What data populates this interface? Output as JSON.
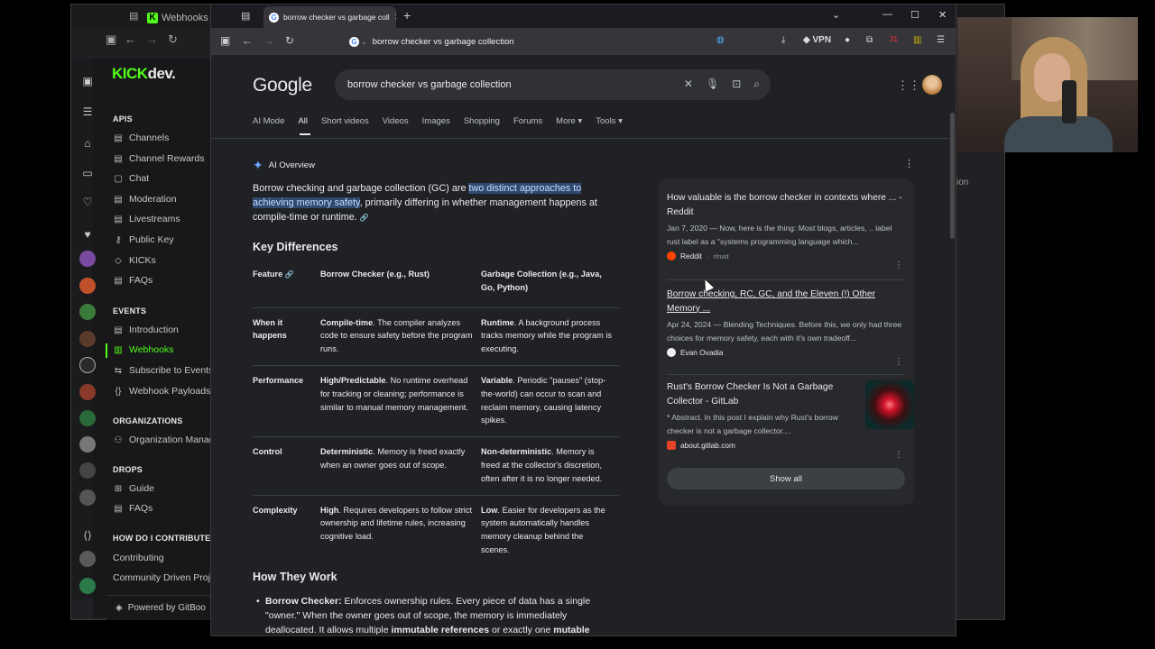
{
  "bg_window": {
    "tab_title": "Webhooks | Ki",
    "right_fragment": "ion",
    "kick": {
      "logo_kick": "KICK",
      "logo_dev": "dev.",
      "sections": [
        {
          "title": "APIS",
          "items": [
            "Channels",
            "Channel Rewards",
            "Chat",
            "Moderation",
            "Livestreams",
            "Public Key",
            "KICKs",
            "FAQs"
          ]
        },
        {
          "title": "EVENTS",
          "items": [
            "Introduction",
            "Webhooks",
            "Subscribe to Events",
            "Webhook Payloads"
          ]
        },
        {
          "title": "ORGANIZATIONS",
          "items": [
            "Organization Manag"
          ]
        },
        {
          "title": "DROPS",
          "items": [
            "Guide",
            "FAQs"
          ]
        },
        {
          "title": "HOW DO I CONTRIBUTE?",
          "items": [
            "Contributing",
            "Community Driven Proje"
          ]
        }
      ],
      "active_item": "Webhooks",
      "gitbook": "Powered by GitBoo"
    }
  },
  "browser": {
    "tab_title": "borrow checker vs garbage coll",
    "address": "borrow checker vs garbage collection",
    "vpn_label": "VPN",
    "badge_count": "31"
  },
  "google": {
    "logo": "Google",
    "query": "borrow checker vs garbage collection",
    "tabs": [
      "AI Mode",
      "All",
      "Short videos",
      "Videos",
      "Images",
      "Shopping",
      "Forums",
      "More",
      "Tools"
    ],
    "active_tab": "All",
    "aio_label": "AI Overview",
    "intro_pre": "Borrow checking and garbage collection (GC) are ",
    "intro_hl": "two distinct approaches to achieving memory safety",
    "intro_post": ", primarily differing in whether management happens at compile-time or runtime.",
    "key_diff_title": "Key Differences",
    "table": {
      "headers": [
        "Feature",
        "Borrow Checker (e.g., Rust)",
        "Garbage Collection (e.g., Java, Go, Python)"
      ],
      "rows": [
        {
          "feature": "When it happens",
          "bc_bold": "Compile-time",
          "bc_rest": ". The compiler analyzes code to ensure safety before the program runs.",
          "gc_bold": "Runtime",
          "gc_rest": ". A background process tracks memory while the program is executing."
        },
        {
          "feature": "Performance",
          "bc_bold": "High/Predictable",
          "bc_rest": ". No runtime overhead for tracking or cleaning; performance is similar to manual memory management.",
          "gc_bold": "Variable",
          "gc_rest": ". Periodic \"pauses\" (stop-the-world) can occur to scan and reclaim memory, causing latency spikes."
        },
        {
          "feature": "Control",
          "bc_bold": "Deterministic",
          "bc_rest": ". Memory is freed exactly when an owner goes out of scope.",
          "gc_bold": "Non-deterministic",
          "gc_rest": ". Memory is freed at the collector's discretion, often after it is no longer needed."
        },
        {
          "feature": "Complexity",
          "bc_bold": "High",
          "bc_rest": ". Requires developers to follow strict ownership and lifetime rules, increasing cognitive load.",
          "gc_bold": "Low",
          "gc_rest": ". Easier for developers as the system automatically handles memory cleanup behind the scenes."
        }
      ]
    },
    "how_title": "How They Work",
    "how_bold": "Borrow Checker:",
    "how_text": " Enforces ownership rules. Every piece of data has a single \"owner.\" When the owner goes out of scope, the memory is immediately deallocated. It allows multiple ",
    "how_b2": "immutable references",
    "how_text2": " or exactly one ",
    "how_b3": "mutable",
    "sources": [
      {
        "title": "How valuable is the borrow checker in contexts where ... - Reddit",
        "snippet": "Jan 7, 2020 — Now, here is the thing: Most blogs, articles, .. label rust label as a \"systems programming language which...",
        "site": "Reddit",
        "sub": "r/rust"
      },
      {
        "title": "Borrow checking, RC, GC, and the Eleven (!) Other Memory ...",
        "snippet": "Apr 24, 2024 — Blending Techniques. Before this, we only had three choices for memory safety, each with it's own tradeoff...",
        "site": "Evan Ovadia",
        "sub": ""
      },
      {
        "title": "Rust's Borrow Checker Is Not a Garbage Collector - GitLab",
        "snippet": "* Abstract. In this post I explain why Rust's borrow checker is not a garbage collector....",
        "site": "about.gitlab.com",
        "sub": ""
      }
    ],
    "show_all": "Show all"
  }
}
